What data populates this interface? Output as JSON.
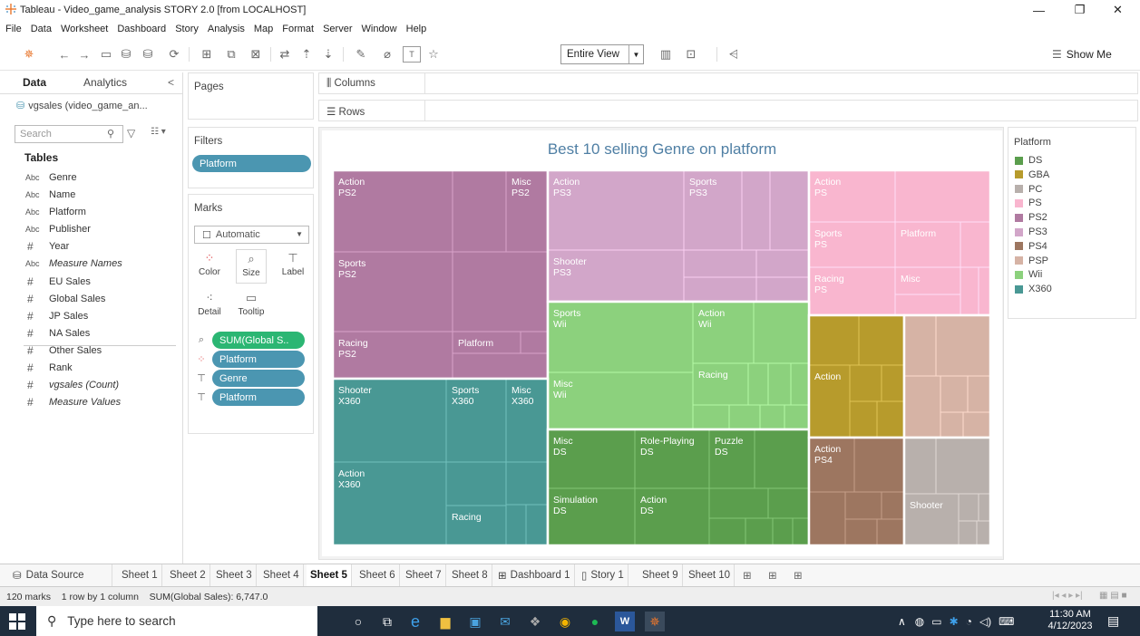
{
  "window": {
    "title": "Tableau - Video_game_analysis STORY 2.0 [from LOCALHOST]",
    "minimize": "—",
    "maximize": "❐",
    "close": "✕"
  },
  "menu": [
    "File",
    "Data",
    "Worksheet",
    "Dashboard",
    "Story",
    "Analysis",
    "Map",
    "Format",
    "Server",
    "Window",
    "Help"
  ],
  "toolbar": {
    "fit_value": "Entire View",
    "show_me_label": "Show Me"
  },
  "data_pane": {
    "tab_data": "Data",
    "tab_analytics": "Analytics",
    "collapse": "<",
    "datasource": "vgsales (video_game_an...",
    "search_placeholder": "Search",
    "tables_heading": "Tables",
    "fields": [
      {
        "type": "Abc",
        "name": "Genre"
      },
      {
        "type": "Abc",
        "name": "Name"
      },
      {
        "type": "Abc",
        "name": "Platform"
      },
      {
        "type": "Abc",
        "name": "Publisher"
      },
      {
        "type": "#",
        "name": "Year"
      },
      {
        "type": "Abc",
        "name": "Measure Names"
      },
      {
        "type": "#",
        "name": "EU Sales"
      },
      {
        "type": "#",
        "name": "Global Sales"
      },
      {
        "type": "#",
        "name": "JP Sales"
      },
      {
        "type": "#",
        "name": "NA Sales"
      },
      {
        "type": "#",
        "name": "Other Sales"
      },
      {
        "type": "#",
        "name": "Rank"
      },
      {
        "type": "#",
        "name": "vgsales (Count)"
      },
      {
        "type": "#",
        "name": "Measure Values"
      }
    ]
  },
  "shelves": {
    "pages": "Pages",
    "filters": "Filters",
    "filter_pill": "Platform",
    "columns": "Columns",
    "rows": "Rows"
  },
  "marks": {
    "title": "Marks",
    "mark_type": "Automatic",
    "buttons": {
      "color": "Color",
      "size": "Size",
      "label": "Label",
      "detail": "Detail",
      "tooltip": "Tooltip"
    },
    "pills": [
      "SUM(Global S..",
      "Platform",
      "Genre",
      "Platform"
    ]
  },
  "legend": {
    "title": "Platform",
    "items": [
      {
        "name": "DS",
        "color": "#5b9e4d"
      },
      {
        "name": "GBA",
        "color": "#b79b2c"
      },
      {
        "name": "PC",
        "color": "#b8b0ac"
      },
      {
        "name": "PS",
        "color": "#f9b6cf"
      },
      {
        "name": "PS2",
        "color": "#b07aa1"
      },
      {
        "name": "PS3",
        "color": "#d2a6c9"
      },
      {
        "name": "PS4",
        "color": "#9d7660"
      },
      {
        "name": "PSP",
        "color": "#d6b3a5"
      },
      {
        "name": "Wii",
        "color": "#8cd17d"
      },
      {
        "name": "X360",
        "color": "#499894"
      }
    ]
  },
  "chart_data": {
    "type": "treemap",
    "title": "Best 10 selling Genre on platform",
    "size_measure": "SUM(Global Sales)",
    "color_by": "Platform",
    "platforms": [
      {
        "platform": "PS2",
        "color": "#b07aa1",
        "labeled": [
          {
            "genre": "Action",
            "label": "Action\nPS2"
          },
          {
            "genre": "Misc",
            "label": "Misc\nPS2"
          },
          {
            "genre": "Sports",
            "label": "Sports\nPS2"
          },
          {
            "genre": "Racing",
            "label": "Racing\nPS2"
          },
          {
            "genre": "Platform",
            "label": "Platform"
          }
        ]
      },
      {
        "platform": "PS3",
        "color": "#d2a6c9",
        "labeled": [
          {
            "genre": "Action",
            "label": "Action\nPS3"
          },
          {
            "genre": "Sports",
            "label": "Sports\nPS3"
          },
          {
            "genre": "Shooter",
            "label": "Shooter\nPS3"
          }
        ]
      },
      {
        "platform": "PS",
        "color": "#f9b6cf",
        "labeled": [
          {
            "genre": "Action",
            "label": "Action\nPS"
          },
          {
            "genre": "Sports",
            "label": "Sports\nPS"
          },
          {
            "genre": "Platform",
            "label": "Platform"
          },
          {
            "genre": "Misc",
            "label": "Misc"
          },
          {
            "genre": "Racing",
            "label": "Racing\nPS"
          }
        ]
      },
      {
        "platform": "Wii",
        "color": "#8cd17d",
        "labeled": [
          {
            "genre": "Sports",
            "label": "Sports\nWii"
          },
          {
            "genre": "Action",
            "label": "Action\nWii"
          },
          {
            "genre": "Racing",
            "label": "Racing"
          },
          {
            "genre": "Misc",
            "label": "Misc\nWii"
          }
        ]
      },
      {
        "platform": "X360",
        "color": "#499894",
        "labeled": [
          {
            "genre": "Shooter",
            "label": "Shooter\nX360"
          },
          {
            "genre": "Sports",
            "label": "Sports\nX360"
          },
          {
            "genre": "Misc",
            "label": "Misc\nX360"
          },
          {
            "genre": "Action",
            "label": "Action\nX360"
          },
          {
            "genre": "Racing",
            "label": "Racing"
          }
        ]
      },
      {
        "platform": "DS",
        "color": "#5b9e4d",
        "labeled": [
          {
            "genre": "Misc",
            "label": "Misc\nDS"
          },
          {
            "genre": "Role-Playing",
            "label": "Role-Playing\nDS"
          },
          {
            "genre": "Puzzle",
            "label": "Puzzle\nDS"
          },
          {
            "genre": "Simulation",
            "label": "Simulation\nDS"
          },
          {
            "genre": "Action",
            "label": "Action\nDS"
          }
        ]
      },
      {
        "platform": "GBA",
        "color": "#b79b2c",
        "labeled": [
          {
            "genre": "Action",
            "label": "Action"
          }
        ]
      },
      {
        "platform": "PSP",
        "color": "#d6b3a5",
        "labeled": []
      },
      {
        "platform": "PS4",
        "color": "#9d7660",
        "labeled": [
          {
            "genre": "Action",
            "label": "Action\nPS4"
          }
        ]
      },
      {
        "platform": "PC",
        "color": "#b8b0ac",
        "labeled": [
          {
            "genre": "Shooter",
            "label": "Shooter"
          }
        ]
      }
    ]
  },
  "sheet_tabs": {
    "data_source": "Data Source",
    "tabs": [
      "Sheet 1",
      "Sheet 2",
      "Sheet 3",
      "Sheet 4",
      "Sheet 5",
      "Sheet 6",
      "Sheet 7",
      "Sheet 8",
      "Dashboard 1",
      "Story 1",
      "Sheet 9",
      "Sheet 10"
    ],
    "active": "Sheet 5"
  },
  "status": {
    "marks": "120 marks",
    "layout": "1 row by 1 column",
    "sum": "SUM(Global Sales): 6,747.0"
  },
  "taskbar": {
    "search_placeholder": "Type here to search",
    "time": "11:30 AM",
    "date": "4/12/2023"
  }
}
